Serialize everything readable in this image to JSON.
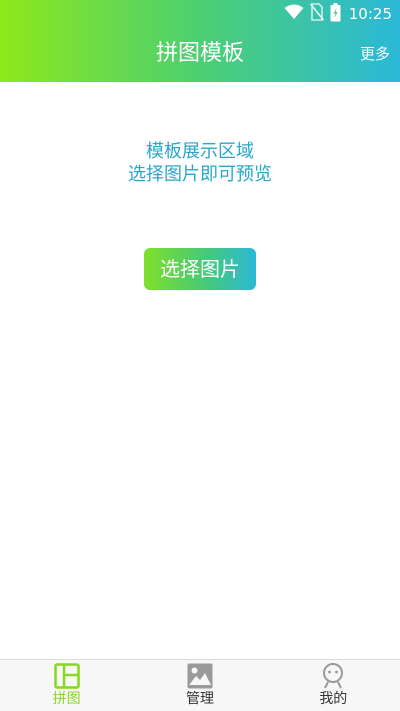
{
  "status_bar": {
    "time": "10:25",
    "icons": [
      "wifi-icon",
      "no-sim-icon",
      "battery-charging-icon"
    ]
  },
  "header": {
    "title": "拼图模板",
    "more_label": "更多"
  },
  "main": {
    "preview_line1": "模板展示区域",
    "preview_line2": "选择图片即可预览",
    "select_button_label": "选择图片"
  },
  "bottom_nav": {
    "items": [
      {
        "label": "拼图",
        "icon": "layout-icon",
        "active": true
      },
      {
        "label": "管理",
        "icon": "image-icon",
        "active": false
      },
      {
        "label": "我的",
        "icon": "profile-icon",
        "active": false
      }
    ]
  },
  "colors": {
    "accent": "#86d91c",
    "text_blue": "#2aa6c9",
    "gradient_start": "#8ee81a",
    "gradient_end": "#2bb8d8",
    "nav_inactive": "#9a9a9a"
  }
}
